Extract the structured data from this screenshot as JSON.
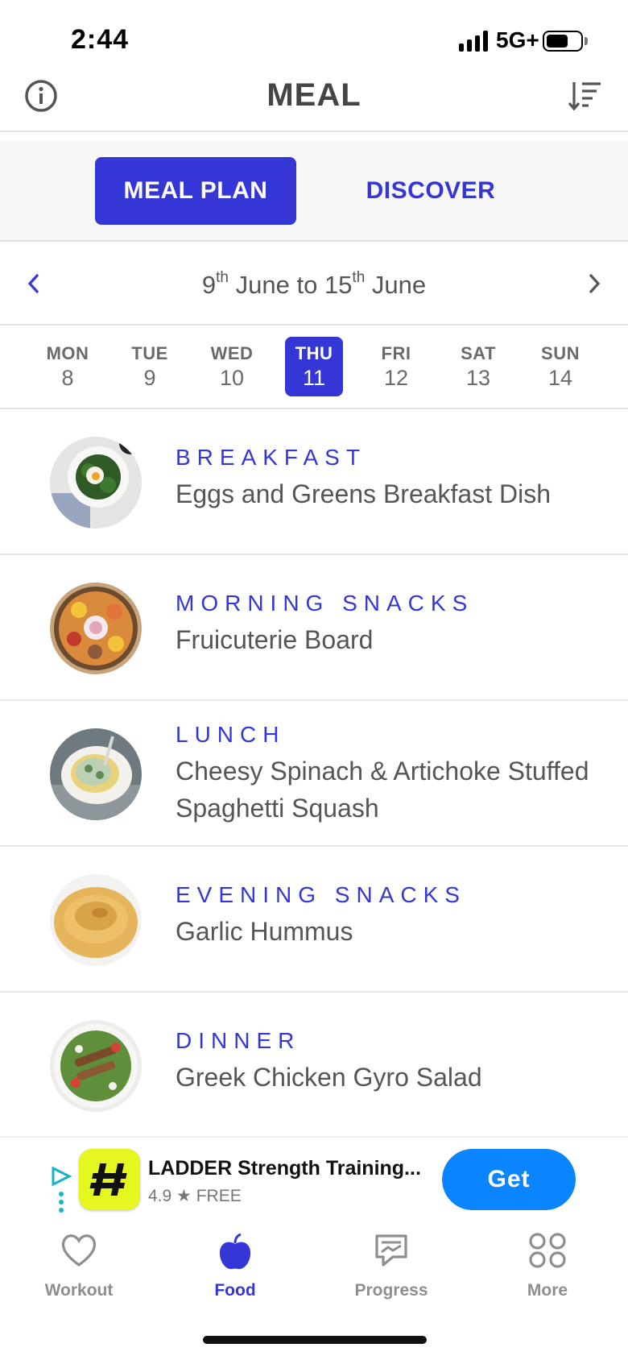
{
  "status_bar": {
    "time": "2:44",
    "network": "5G+"
  },
  "header": {
    "title": "MEAL",
    "left_icon": "info-icon",
    "right_icon": "sort-icon"
  },
  "tabs": [
    {
      "label": "MEAL PLAN",
      "active": true
    },
    {
      "label": "DISCOVER",
      "active": false
    }
  ],
  "week": {
    "start_day": "9",
    "start_suffix": "th",
    "start_month": "June",
    "connector": "to",
    "end_day": "15",
    "end_suffix": "th",
    "end_month": "June"
  },
  "days": [
    {
      "name": "MON",
      "num": "8",
      "active": false
    },
    {
      "name": "TUE",
      "num": "9",
      "active": false
    },
    {
      "name": "WED",
      "num": "10",
      "active": false
    },
    {
      "name": "THU",
      "num": "11",
      "active": true
    },
    {
      "name": "FRI",
      "num": "12",
      "active": false
    },
    {
      "name": "SAT",
      "num": "13",
      "active": false
    },
    {
      "name": "SUN",
      "num": "14",
      "active": false
    }
  ],
  "meals": [
    {
      "label": "BREAKFAST",
      "name": "Eggs and Greens Breakfast Dish",
      "thumb": "breakfast-dish-image"
    },
    {
      "label": "MORNING SNACKS",
      "name": "Fruicuterie Board",
      "thumb": "fruit-board-image"
    },
    {
      "label": "LUNCH",
      "name": "Cheesy Spinach & Artichoke Stuffed Spaghetti Squash",
      "thumb": "stuffed-squash-image"
    },
    {
      "label": "EVENING SNACKS",
      "name": "Garlic Hummus",
      "thumb": "hummus-image"
    },
    {
      "label": "DINNER",
      "name": "Greek Chicken Gyro Salad",
      "thumb": "gyro-salad-image"
    }
  ],
  "ad": {
    "title": "LADDER Strength Training...",
    "rating": "4.9",
    "price": "FREE",
    "cta": "Get"
  },
  "bottom_nav": [
    {
      "label": "Workout",
      "icon": "heart-icon",
      "active": false
    },
    {
      "label": "Food",
      "icon": "apple-icon",
      "active": true
    },
    {
      "label": "Progress",
      "icon": "progress-icon",
      "active": false
    },
    {
      "label": "More",
      "icon": "grid-icon",
      "active": false
    }
  ],
  "colors": {
    "accent": "#3437d6",
    "ad_button": "#0a84ff",
    "ad_logo": "#e6f61f"
  }
}
